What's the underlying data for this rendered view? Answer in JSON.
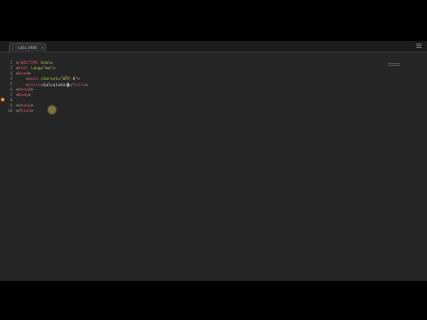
{
  "tab": {
    "title": "calc.html",
    "close": "×"
  },
  "gutter": {
    "lines": [
      "1",
      "2",
      "3",
      "4",
      "5",
      "6",
      "7",
      "8",
      "9",
      "10"
    ]
  },
  "code": {
    "l1": {
      "open": "<",
      "kw": "!DOCTYPE",
      "rest": " html",
      "close": ">"
    },
    "l2": {
      "open": "<",
      "tag": "html",
      "attr": " lang",
      "eq": "=",
      "val": "\"en\"",
      "close": ">"
    },
    "l3": {
      "open": "<",
      "tag": "head",
      "close": ">"
    },
    "l4": {
      "indent": "    ",
      "open": "<",
      "tag": "meta",
      "attr": " charset",
      "eq": "=",
      "val": "\"UTF-8\"",
      "close": ">"
    },
    "l5": {
      "indent": "    ",
      "open1": "<",
      "tag1": "title",
      "close1": ">",
      "text": "Calculator",
      "open2": "</",
      "tag2": "title",
      "close2": ">"
    },
    "l6": {
      "open": "</",
      "tag": "head",
      "close": ">"
    },
    "l7": {
      "open": "<",
      "tag": "body",
      "close": ">"
    },
    "l8": {
      "text": ""
    },
    "l9": {
      "open": "</",
      "tag": "body",
      "close": ">"
    },
    "l10": {
      "open": "</",
      "tag": "html",
      "close": ">"
    }
  },
  "colors": {
    "tag": "#e0566f",
    "attr": "#a6d046",
    "string": "#e6db74",
    "background": "#262626"
  }
}
